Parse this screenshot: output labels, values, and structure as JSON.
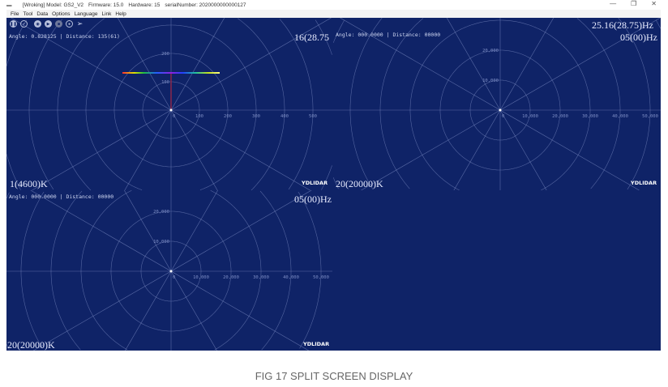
{
  "window": {
    "title_parts": [
      "[Wroking] Model: GS2_V2",
      "Firmware: 15.0",
      "Hardware: 15",
      "serialNumber: 2020000000000127"
    ],
    "minimize": "—",
    "maximize": "❐",
    "close": "✕"
  },
  "menu": [
    "File",
    "Tool",
    "Data",
    "Options",
    "Language",
    "Link",
    "Help"
  ],
  "toolbar": [
    {
      "name": "pause",
      "glyph": "❚❚"
    },
    {
      "name": "check",
      "glyph": "✓"
    },
    {
      "name": "record",
      "glyph": "◉"
    },
    {
      "name": "play",
      "glyph": "▶"
    },
    {
      "name": "stop",
      "glyph": "■"
    },
    {
      "name": "target",
      "glyph": "●"
    },
    {
      "name": "send",
      "glyph": "➢"
    }
  ],
  "panels": [
    {
      "id": "tl",
      "info": "Angle: 0.828125 | Distance: 135(61)",
      "hz1": "16(28.75",
      "hz2": "",
      "kelvin": "1(4600)K",
      "brand": "YDLIDAR",
      "x_ticks": [
        "0",
        "100",
        "200",
        "300",
        "400",
        "500"
      ],
      "y_ticks": [
        "100",
        "200"
      ],
      "scan": true
    },
    {
      "id": "tr",
      "info": "Angle: 000.0000 | Distance: 00000",
      "hz1": "25.16(28.75)Hz",
      "hz2": "05(00)Hz",
      "kelvin": "20(20000)K",
      "brand": "YDLIDAR",
      "x_ticks": [
        "0",
        "10,000",
        "20,000",
        "30,000",
        "40,000",
        "50,000"
      ],
      "y_ticks": [
        "10,000",
        "20,000"
      ],
      "scan": false
    },
    {
      "id": "bl",
      "info": "Angle: 000.0000 | Distance: 00000",
      "hz1": "05(00)Hz",
      "hz2": "",
      "kelvin": "20(20000)K",
      "brand": "YDLIDAR",
      "x_ticks": [
        "0",
        "10,000",
        "20,000",
        "30,000",
        "40,000",
        "50,000"
      ],
      "y_ticks": [
        "10,000",
        "20,000"
      ],
      "scan": false
    }
  ],
  "caption": "FIG 17 SPLIT SCREEN DISPLAY",
  "colors": {
    "background": "#0f2367",
    "grid": "#8c9bd0"
  }
}
